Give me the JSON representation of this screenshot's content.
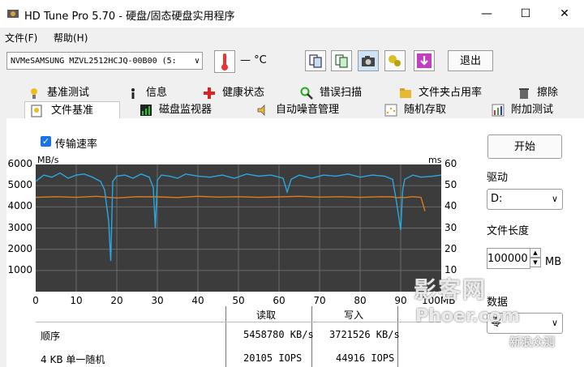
{
  "window": {
    "title": "HD Tune Pro 5.70 - 硬盘/固态硬盘实用程序",
    "minimize": "—",
    "maximize": "☐",
    "close": "✕"
  },
  "menu": {
    "file": "文件(F)",
    "help": "帮助(H)"
  },
  "toolbar": {
    "drive": "NVMeSAMSUNG MZVL2512HCJQ-00B00 (5:",
    "temperature": "— °C",
    "exit": "退出",
    "icons": [
      "copy-icon",
      "copy-text-icon",
      "camera-icon",
      "options-icon",
      "save-icon"
    ]
  },
  "tabs_row1": [
    {
      "label": "基准测试",
      "icon": "benchmark-icon"
    },
    {
      "label": "信息",
      "icon": "info-icon"
    },
    {
      "label": "健康状态",
      "icon": "health-icon"
    },
    {
      "label": "错误扫描",
      "icon": "error-scan-icon"
    },
    {
      "label": "文件夹占用率",
      "icon": "folder-icon"
    },
    {
      "label": "擦除",
      "icon": "erase-icon"
    }
  ],
  "tabs_row2": [
    {
      "label": "文件基准",
      "icon": "file-benchmark-icon",
      "selected": true
    },
    {
      "label": "磁盘监视器",
      "icon": "disk-monitor-icon"
    },
    {
      "label": "自动噪音管理",
      "icon": "speaker-icon"
    },
    {
      "label": "随机存取",
      "icon": "random-access-icon"
    },
    {
      "label": "附加测试",
      "icon": "extra-tests-icon"
    }
  ],
  "options": {
    "transfer_rate_label": "传输速率",
    "transfer_rate_checked": true
  },
  "chart_data": {
    "type": "line",
    "y_left_label": "MB/s",
    "y_right_label": "ms",
    "ylim": [
      0,
      6000
    ],
    "ylim_right": [
      0,
      60
    ],
    "y_left_ticks": [
      "6000",
      "5000",
      "4000",
      "3000",
      "2000",
      "1000"
    ],
    "y_right_ticks": [
      "60",
      "50",
      "40",
      "30",
      "20",
      "10"
    ],
    "x_ticks": [
      "0",
      "10",
      "20",
      "30",
      "40",
      "50",
      "60",
      "70",
      "80",
      "90"
    ],
    "x_unit": "100MB",
    "xlim": [
      0,
      100
    ],
    "grid": true,
    "series": [
      {
        "color": "#2aa8e0",
        "x": [
          0,
          2,
          4,
          6,
          8,
          10,
          12,
          14,
          16,
          17,
          18,
          18.5,
          19,
          20,
          22,
          24,
          26,
          28,
          29,
          29.5,
          30,
          31,
          33,
          35,
          37,
          40,
          43,
          46,
          49,
          52,
          55,
          58,
          61,
          62,
          63,
          65,
          68,
          71,
          74,
          77,
          80,
          83,
          86,
          88,
          89,
          90,
          90.5,
          91,
          93,
          95,
          98,
          100
        ],
        "y": [
          5200,
          5500,
          5400,
          5600,
          5350,
          5500,
          5550,
          5400,
          5200,
          4800,
          3300,
          1450,
          5200,
          5450,
          5500,
          5350,
          5550,
          5400,
          4900,
          3000,
          5250,
          5500,
          5450,
          5350,
          5550,
          5450,
          5400,
          5500,
          5350,
          5550,
          5450,
          5500,
          5350,
          4700,
          5300,
          5500,
          5350,
          5500,
          5450,
          5550,
          5400,
          5500,
          5450,
          5300,
          4200,
          2900,
          4800,
          5300,
          5500,
          5400,
          5450,
          5500
        ]
      },
      {
        "color": "#e07b1a",
        "x": [
          0,
          5,
          10,
          15,
          20,
          25,
          30,
          35,
          40,
          45,
          50,
          55,
          60,
          65,
          70,
          75,
          80,
          85,
          88,
          89,
          90,
          91,
          93,
          95,
          96
        ],
        "y": [
          4450,
          4480,
          4450,
          4500,
          4420,
          4480,
          4470,
          4440,
          4500,
          4460,
          4480,
          4450,
          4470,
          4500,
          4460,
          4480,
          4450,
          4480,
          4470,
          4430,
          4450,
          4440,
          4480,
          4450,
          3800
        ]
      }
    ]
  },
  "results": {
    "col_read": "读取",
    "col_write": "写入",
    "rows": [
      {
        "label": "顺序",
        "read": "5458780 KB/s",
        "write": "3721526 KB/s"
      },
      {
        "label": "4 KB 单一随机",
        "read": "20105 IOPS",
        "write": "44916 IOPS"
      }
    ]
  },
  "side": {
    "start": "开始",
    "drive_label": "驱动",
    "drive_value": "D:",
    "file_length_label": "文件长度",
    "file_length_value": "100000",
    "file_length_unit": "MB",
    "data_label": "数据",
    "data_value": "零"
  },
  "watermark": {
    "line1": "影客网",
    "line2": "Phoer.com",
    "line3": "新浪众测"
  }
}
